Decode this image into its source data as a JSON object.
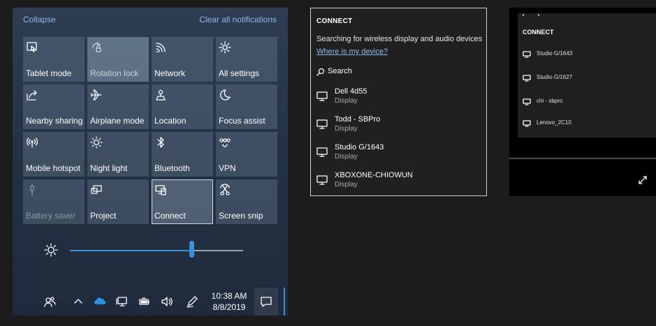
{
  "action_center": {
    "collapse_label": "Collapse",
    "clear_label": "Clear all notifications",
    "tiles": [
      {
        "label": "Tablet mode",
        "icon": "tablet-mode-icon"
      },
      {
        "label": "Rotation lock",
        "icon": "rotation-lock-icon"
      },
      {
        "label": "Network",
        "icon": "network-icon"
      },
      {
        "label": "All settings",
        "icon": "gear-icon"
      },
      {
        "label": "Nearby sharing",
        "icon": "share-icon"
      },
      {
        "label": "Airplane mode",
        "icon": "airplane-icon"
      },
      {
        "label": "Location",
        "icon": "location-icon"
      },
      {
        "label": "Focus assist",
        "icon": "moon-icon"
      },
      {
        "label": "Mobile hotspot",
        "icon": "hotspot-icon"
      },
      {
        "label": "Night light",
        "icon": "sun-icon"
      },
      {
        "label": "Bluetooth",
        "icon": "bluetooth-icon"
      },
      {
        "label": "VPN",
        "icon": "vpn-icon"
      },
      {
        "label": "Battery saver",
        "icon": "battery-saver-icon"
      },
      {
        "label": "Project",
        "icon": "project-icon"
      },
      {
        "label": "Connect",
        "icon": "connect-icon"
      },
      {
        "label": "Screen snip",
        "icon": "screen-snip-icon"
      }
    ],
    "brightness_percent": 70,
    "accent_color": "#3f8fd8"
  },
  "taskbar": {
    "time": "10:38 AM",
    "date": "8/8/2019"
  },
  "connect": {
    "title": "CONNECT",
    "status": "Searching for wireless display and audio devices",
    "help_link": "Where is my device?",
    "search_label": "Search",
    "devices": [
      {
        "name": "Dell 4d55",
        "type": "Display"
      },
      {
        "name": "Todd - SBPro",
        "type": "Display"
      },
      {
        "name": "Studio G/1643",
        "type": "Display"
      },
      {
        "name": "XBOXONE-CHIOWUN",
        "type": "Display"
      }
    ]
  },
  "connect_small": {
    "title": "CONNECT",
    "devices": [
      {
        "name": "Studio G/1643"
      },
      {
        "name": "Studio G/1627"
      },
      {
        "name": "chi - sbpro"
      },
      {
        "name": "Lenovo_2C10"
      }
    ]
  }
}
